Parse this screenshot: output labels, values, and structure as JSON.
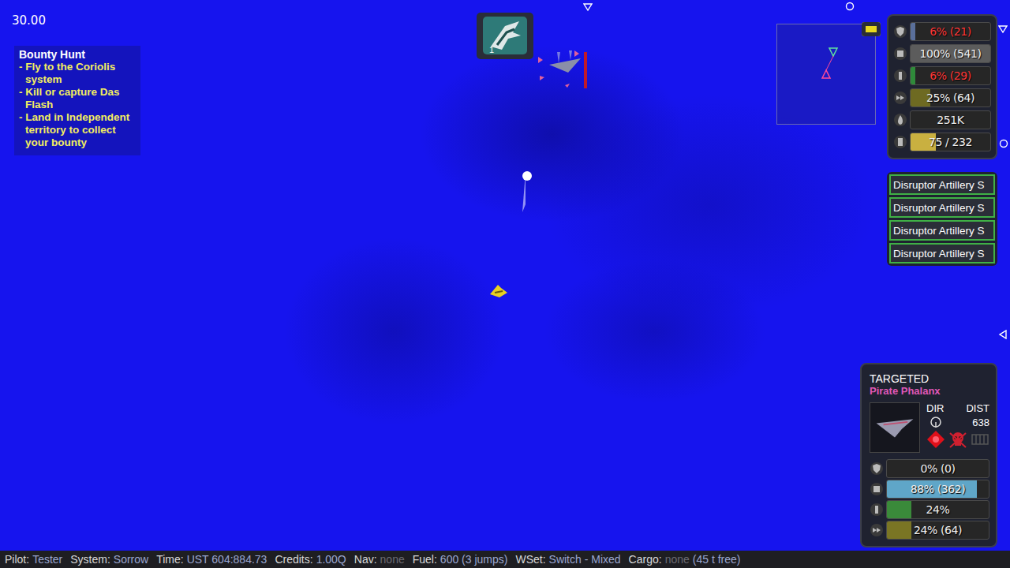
{
  "timer": "30.00",
  "mission": {
    "title": "Bounty Hunt",
    "steps": [
      "- Fly to the Coriolis system",
      "- Kill or capture Das Flash",
      "- Land in Independent territory to collect your bounty"
    ]
  },
  "ability": {
    "count": "1"
  },
  "player_status": [
    {
      "kind": "shield",
      "value": "6% (21)",
      "level": 0.06,
      "critical": true
    },
    {
      "kind": "armor",
      "value": "100% (541)",
      "level": 1,
      "critical": false
    },
    {
      "kind": "energy",
      "value": "6% (29)",
      "level": 0.06,
      "critical": true
    },
    {
      "kind": "speed",
      "value": "25% (64)",
      "level": 0.25,
      "critical": false
    },
    {
      "kind": "fuel",
      "value": "251K",
      "level": 0,
      "critical": false
    },
    {
      "kind": "cargo",
      "value": "75 / 232",
      "level": 0.32,
      "critical": false
    }
  ],
  "weapons": [
    {
      "name": "Disruptor Artillery S",
      "ready": true
    },
    {
      "name": "Disruptor Artillery S",
      "ready": true
    },
    {
      "name": "Disruptor Artillery S",
      "ready": true
    },
    {
      "name": "Disruptor Artillery S",
      "ready": true
    }
  ],
  "target": {
    "heading": "TARGETED",
    "name": "Pirate Phalanx",
    "dir_label": "DIR",
    "dist_label": "DIST",
    "distance": "638",
    "hostile": true,
    "bars": [
      {
        "kind": "shield",
        "value": "0% (0)",
        "level": 0
      },
      {
        "kind": "armor",
        "value": "88% (362)",
        "level": 0.88
      },
      {
        "kind": "energy",
        "value": "24%",
        "level": 0.24
      },
      {
        "kind": "speed",
        "value": "24% (64)",
        "level": 0.24
      }
    ]
  },
  "status_bar": [
    {
      "label": "Pilot:",
      "value": "Tester",
      "muted": false,
      "extra": ""
    },
    {
      "label": "System:",
      "value": "Sorrow",
      "muted": false,
      "extra": ""
    },
    {
      "label": "Time:",
      "value": "UST 604:884.73",
      "muted": false,
      "extra": ""
    },
    {
      "label": "Credits:",
      "value": "1.00Q",
      "muted": false,
      "extra": ""
    },
    {
      "label": "Nav:",
      "value": "none",
      "muted": true,
      "extra": ""
    },
    {
      "label": "Fuel:",
      "value": "600 (3 jumps)",
      "muted": false,
      "extra": ""
    },
    {
      "label": "WSet:",
      "value": "Switch - Mixed",
      "muted": false,
      "extra": ""
    },
    {
      "label": "Cargo:",
      "value": "none",
      "muted": true,
      "extra": "(45 t free)"
    }
  ]
}
